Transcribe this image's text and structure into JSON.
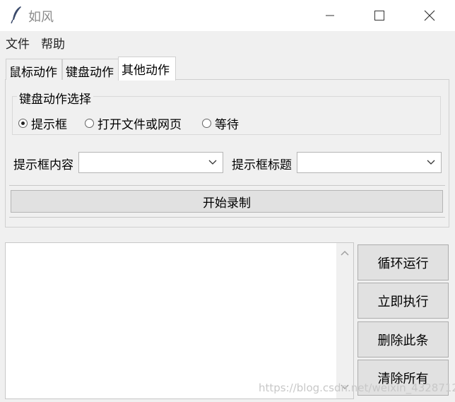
{
  "window": {
    "title": "如风"
  },
  "menu": {
    "file": "文件",
    "help": "帮助"
  },
  "tabs": [
    {
      "label": "鼠标动作",
      "active": false
    },
    {
      "label": "键盘动作",
      "active": false
    },
    {
      "label": "其他动作",
      "active": true
    }
  ],
  "group": {
    "title": "键盘动作选择",
    "options": [
      {
        "label": "提示框",
        "selected": true
      },
      {
        "label": "打开文件或网页",
        "selected": false
      },
      {
        "label": "等待",
        "selected": false
      }
    ]
  },
  "fields": {
    "content_label": "提示框内容",
    "content_value": "",
    "title_label": "提示框标题",
    "title_value": ""
  },
  "record_button": "开始录制",
  "side_buttons": {
    "loop": "循环运行",
    "run_now": "立即执行",
    "delete": "删除此条",
    "clear": "清除所有"
  },
  "watermark": "https://blog.csdn.net/weixin_43287121"
}
